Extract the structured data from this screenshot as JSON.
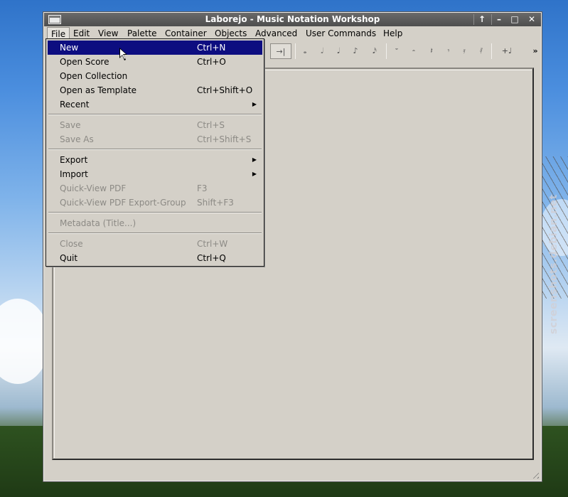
{
  "window": {
    "title": "Laborejo - Music Notation Workshop",
    "controls": {
      "keep_above": "↑",
      "minimize": "–",
      "maximize": "□",
      "close": "✕"
    }
  },
  "menubar": [
    "File",
    "Edit",
    "View",
    "Palette",
    "Container",
    "Objects",
    "Advanced",
    "User Commands",
    "Help"
  ],
  "toolbar": {
    "tab_end": "→|",
    "notes": [
      "𝅝",
      "𝅗𝅥",
      "𝅘𝅥",
      "♪",
      "𝅘𝅥𝅯"
    ],
    "rests": [
      "𝄻",
      "𝄼",
      "𝄽",
      "𝄾",
      "𝄿",
      "𝅀"
    ],
    "add_note": "+♩",
    "overflow": "»"
  },
  "file_menu": {
    "items": [
      {
        "label": "New",
        "shortcut": "Ctrl+N",
        "highlighted": true
      },
      {
        "label": "Open Score",
        "shortcut": "Ctrl+O"
      },
      {
        "label": "Open Collection",
        "shortcut": ""
      },
      {
        "label": "Open as Template",
        "shortcut": "Ctrl+Shift+O"
      },
      {
        "label": "Recent",
        "submenu": true
      },
      {
        "label": "Save",
        "shortcut": "Ctrl+S",
        "disabled": true
      },
      {
        "label": "Save As",
        "shortcut": "Ctrl+Shift+S",
        "disabled": true
      },
      {
        "label": "Export",
        "submenu": true
      },
      {
        "label": "Import",
        "submenu": true
      },
      {
        "label": "Quick-View PDF",
        "shortcut": "F3",
        "disabled": true
      },
      {
        "label": "Quick-View PDF Export-Group",
        "shortcut": "Shift+F3",
        "disabled": true
      },
      {
        "label": "Metadata (Title...)",
        "disabled": true
      },
      {
        "label": "Close",
        "shortcut": "Ctrl+W",
        "disabled": true
      },
      {
        "label": "Quit",
        "shortcut": "Ctrl+Q"
      }
    ],
    "submenu_arrow": "▶"
  },
  "watermark": "screenshots.debian.net",
  "colors": {
    "highlight": "#0d0d80",
    "window_bg": "#d4d0c8",
    "titlebar": "#555555"
  }
}
